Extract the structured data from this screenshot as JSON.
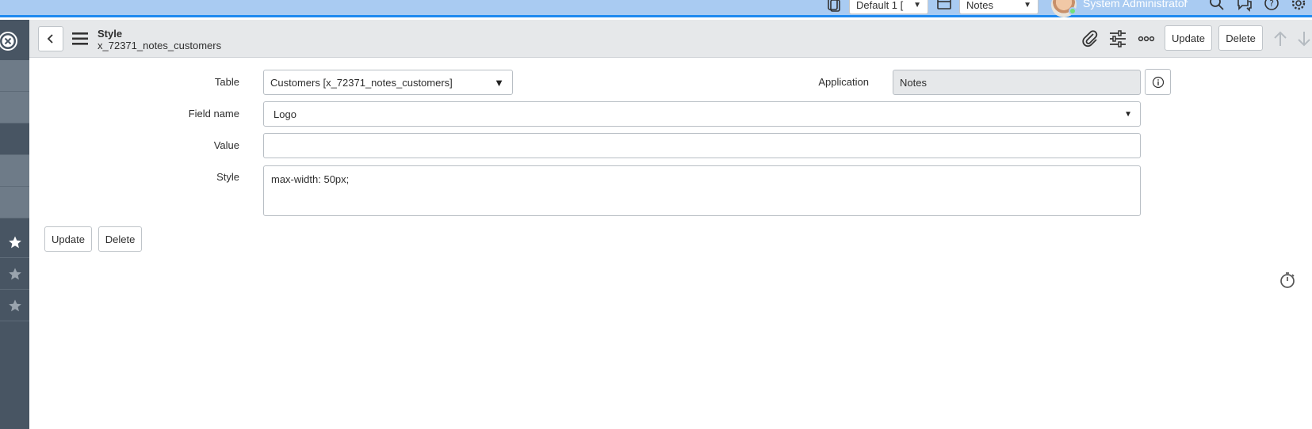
{
  "topbar": {
    "update_set": "Default 1 [",
    "application_scope": "Notes",
    "user_name": "System Administrator",
    "icons": [
      "update-set-icon",
      "application-icon",
      "search-icon",
      "connect-chat-icon",
      "help-icon",
      "gear-icon"
    ]
  },
  "leftnav": {
    "icons": [
      "close-circle-icon",
      "star-icon",
      "star-icon",
      "star-icon"
    ]
  },
  "header": {
    "title": "Style",
    "subtitle": "x_72371_notes_customers",
    "update_label": "Update",
    "delete_label": "Delete",
    "icons": [
      "back-icon",
      "menu-icon",
      "paperclip-icon",
      "sliders-icon",
      "more-icon",
      "arrow-up-icon",
      "arrow-down-icon"
    ]
  },
  "form": {
    "table_label": "Table",
    "table_value": "Customers [x_72371_notes_customers]",
    "application_label": "Application",
    "application_value": "Notes",
    "field_name_label": "Field name",
    "field_name_value": "Logo",
    "value_label": "Value",
    "value_value": "",
    "style_label": "Style",
    "style_value": "max-width: 50px;",
    "update_label": "Update",
    "delete_label": "Delete"
  },
  "colors": {
    "banner": "#a9cbf2",
    "banner_accent": "#1f8af0",
    "nav_dark": "#485563",
    "header_bg": "#e6e8ea"
  }
}
